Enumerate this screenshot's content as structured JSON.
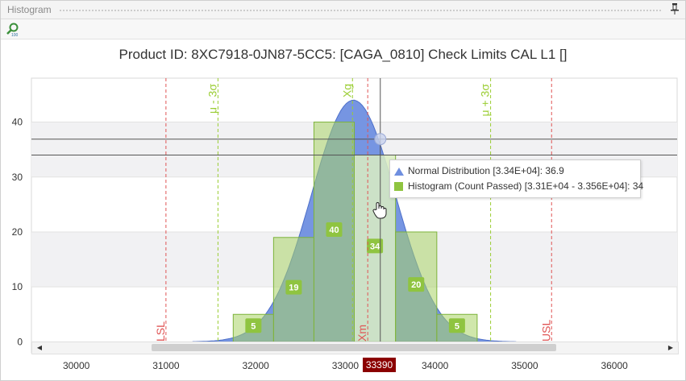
{
  "panel": {
    "title": "Histogram",
    "pin_icon": "pin-icon",
    "zoom_icon": "zoom-100-icon"
  },
  "chart_data": {
    "type": "bar",
    "title": "Product ID: 8XC7918-0JN87-5CC5: [CAGA_0810] Check Limits CAL L1 []",
    "xlim": [
      29500,
      36700
    ],
    "ylim": [
      -2,
      48
    ],
    "x_ticks": [
      30000,
      31000,
      32000,
      33000,
      34000,
      35000,
      36000
    ],
    "y_ticks": [
      0,
      10,
      20,
      30,
      40
    ],
    "grid": true,
    "series": [
      {
        "name": "Histogram (Count Passed)",
        "color": "#8fc440",
        "bins": [
          {
            "start": 31750,
            "end": 32200,
            "value": 5
          },
          {
            "start": 32200,
            "end": 32650,
            "value": 19
          },
          {
            "start": 32650,
            "end": 33100,
            "value": 40
          },
          {
            "start": 33100,
            "end": 33560,
            "value": 34
          },
          {
            "start": 33560,
            "end": 34020,
            "value": 20
          },
          {
            "start": 34020,
            "end": 34470,
            "value": 5
          }
        ]
      },
      {
        "name": "Normal Distribution",
        "color": "#6f8fe0",
        "mean": 33090,
        "sd": 470,
        "peak": 44,
        "x_min": 31300,
        "x_max": 34900
      }
    ],
    "reference_lines": [
      {
        "label": "LSL",
        "x": 31000,
        "color": "#e05555",
        "style": "dashed"
      },
      {
        "label": "μ - 3σ",
        "x": 31580,
        "color": "#9acd32",
        "style": "dashed"
      },
      {
        "label": "Xg",
        "x": 33080,
        "color": "#9acd32",
        "style": "dashed"
      },
      {
        "label": "Xm",
        "x": 33250,
        "color": "#e05555",
        "style": "dashed"
      },
      {
        "label": "μ + 3σ",
        "x": 34620,
        "color": "#9acd32",
        "style": "dashed"
      },
      {
        "label": "USL",
        "x": 35300,
        "color": "#e05555",
        "style": "dashed"
      }
    ],
    "crosshair": {
      "x": 33390,
      "y_values": [
        36.9,
        34
      ],
      "x_label": "33390"
    },
    "tooltip": {
      "normal_text": "Normal Distribution [3.34E+04]: 36.9",
      "histogram_text": "Histogram (Count Passed) [3.31E+04 - 3.356E+04]: 34"
    }
  }
}
